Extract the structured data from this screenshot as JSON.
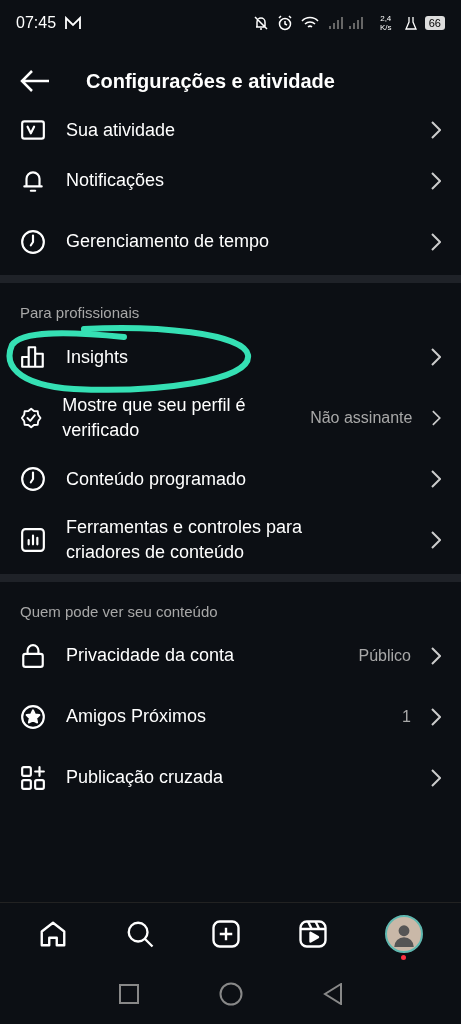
{
  "status_bar": {
    "time": "07:45",
    "speed": "2,4 K/s",
    "battery": "66"
  },
  "header": {
    "title": "Configurações e atividade"
  },
  "sections": [
    {
      "items": [
        {
          "label": "Sua atividade"
        },
        {
          "label": "Notificações"
        },
        {
          "label": "Gerenciamento de tempo"
        }
      ]
    },
    {
      "title": "Para profissionais",
      "items": [
        {
          "label": "Insights",
          "circled": true
        },
        {
          "label": "Mostre que seu perfil é verificado",
          "value": "Não assinante"
        },
        {
          "label": "Conteúdo programado"
        },
        {
          "label": "Ferramentas e controles para criadores de conteúdo"
        }
      ]
    },
    {
      "title": "Quem pode ver seu conteúdo",
      "items": [
        {
          "label": "Privacidade da conta",
          "value": "Público"
        },
        {
          "label": "Amigos Próximos",
          "value": "1"
        },
        {
          "label": "Publicação cruzada"
        }
      ]
    }
  ],
  "bottom_nav": [
    {
      "selected": false
    },
    {
      "selected": false
    },
    {
      "selected": false
    },
    {
      "selected": false
    },
    {
      "selected": false
    }
  ]
}
